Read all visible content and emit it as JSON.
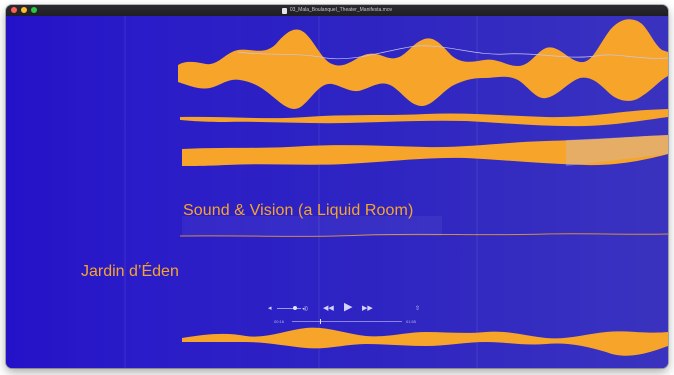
{
  "window": {
    "title": "03_Mala_Boulanquel_Theater_Manifesta.mov"
  },
  "titles": {
    "main": "Sound & Vision (a Liquid Room)",
    "sub": "Jardin d’Éden"
  },
  "player": {
    "elapsed": "00:16",
    "remaining": "01:55",
    "volume_level": 0.75,
    "progress": 0.26,
    "icons": {
      "volume_low": "speaker-low-icon",
      "volume_high": "speaker-high-icon",
      "rewind": "rewind-icon",
      "play": "play-icon",
      "fast_forward": "fast-forward-icon",
      "share": "share-icon"
    }
  },
  "colors": {
    "background": "#2a1cc8",
    "waveform": "#f7a52a",
    "text": "#f7a52a"
  }
}
